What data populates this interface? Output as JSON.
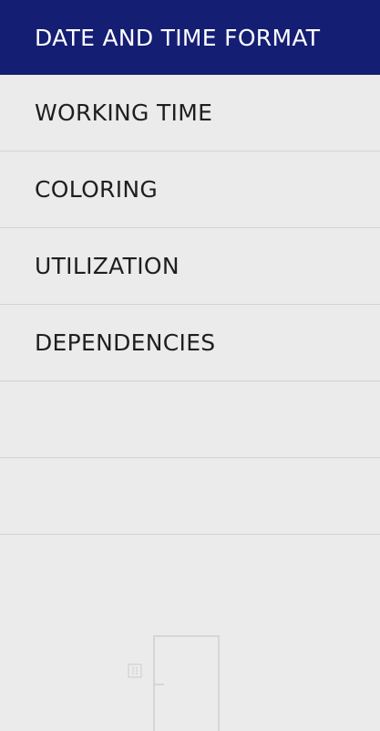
{
  "menu": {
    "items": [
      {
        "label": "DATE AND TIME FORMAT",
        "active": true
      },
      {
        "label": "WORKING TIME",
        "active": false
      },
      {
        "label": "COLORING",
        "active": false
      },
      {
        "label": "UTILIZATION",
        "active": false
      },
      {
        "label": "DEPENDENCIES",
        "active": false
      }
    ]
  },
  "colors": {
    "active_bg": "#141e73",
    "active_text": "#ffffff",
    "item_text": "#1f1f1f",
    "background": "#ebebeb",
    "divider": "#d3d3d3"
  },
  "icons": {
    "illustration": "door-icon"
  }
}
